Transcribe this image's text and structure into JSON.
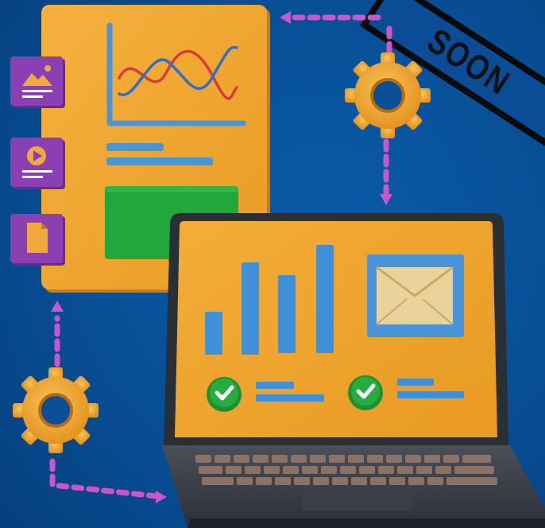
{
  "banner": {
    "text": "SOON"
  },
  "icons": {
    "image": "image-file-icon",
    "video": "video-play-icon",
    "document": "document-icon",
    "gear": "gear-icon",
    "email": "envelope-icon",
    "check": "check-circle-icon"
  },
  "colors": {
    "background": "#07519a",
    "panel": "#f0a630",
    "purple": "#8a3fb2",
    "green": "#23a83a",
    "blue": "#3f90d8",
    "gear": "#f2a93a",
    "connector": "#c957c9"
  }
}
